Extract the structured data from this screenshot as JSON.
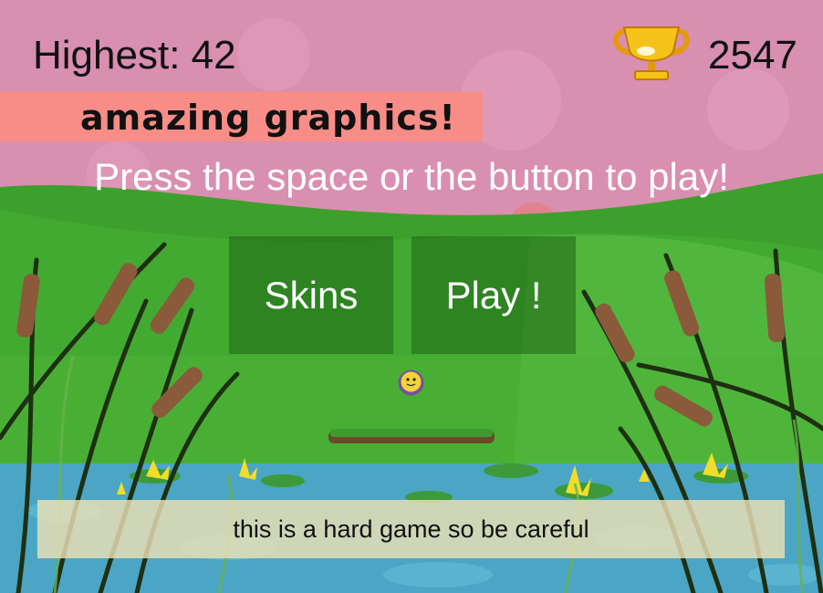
{
  "hud": {
    "highest_label": "Highest: 42",
    "score": "2547",
    "trophy_icon": "trophy-icon"
  },
  "banner": {
    "text": "amazing graphics!",
    "color": "#f88d88"
  },
  "prompt": "Press the space or the button to play!",
  "menu": {
    "skins_label": "Skins",
    "play_label": "Play !"
  },
  "hint": "this is a hard game so be careful",
  "colors": {
    "sky": "#d98fb0",
    "grass": "#3aa82a",
    "water": "#4aa6c4",
    "button_bg": "#2f6e22",
    "banner": "#f88d88"
  }
}
